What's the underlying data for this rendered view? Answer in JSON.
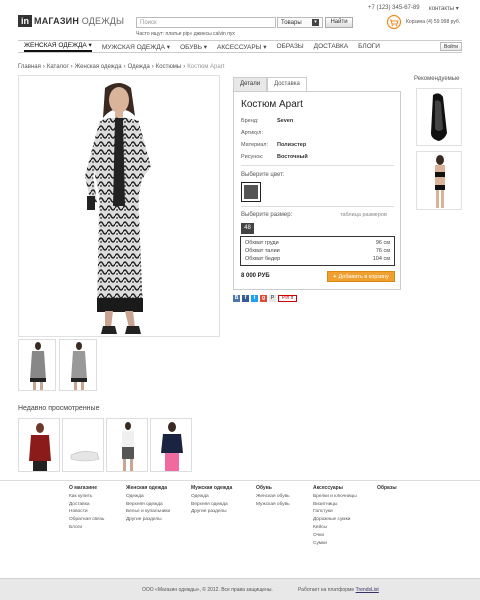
{
  "header": {
    "logo_mark": "in",
    "logo_word": "МАГАЗИН",
    "logo_word2": "ОДЕЖДЫ",
    "search_placeholder": "Поиск",
    "category": "Товары",
    "find_label": "Найти",
    "often_search": "Часто ищут: платье pip» джинсы calvin пух",
    "phone": "+7 (123) 345-67-89",
    "contacts": "контакты ▾",
    "cart_text": "Корзина (4) 59 998 руб."
  },
  "nav": {
    "items": [
      "ЖЕНСКАЯ ОДЕЖДА ▾",
      "МУЖСКАЯ ОДЕЖДА ▾",
      "ОБУВЬ ▾",
      "АКСЕССУАРЫ ▾",
      "ОБРАЗЫ",
      "ДОСТАВКА",
      "БЛОГИ"
    ],
    "login": "Войти"
  },
  "breadcrumb": [
    "Главная",
    "Каталог",
    "Женская одежда",
    "Одежда",
    "Костюмы",
    "Костюм Apart"
  ],
  "details": {
    "tabs": [
      "Детали",
      "Доставка"
    ],
    "title": "Костюм Apart",
    "specs": [
      {
        "label": "Бренд:",
        "value": "Seven"
      },
      {
        "label": "Артикул:",
        "value": ""
      },
      {
        "label": "Материал:",
        "value": "Полиэстер"
      },
      {
        "label": "Рисунок:",
        "value": "Восточный"
      }
    ],
    "color_label": "Выберите цвет:",
    "size_label": "Выберите размер:",
    "size_table": "таблица размеров",
    "size": "48",
    "measurements": [
      {
        "name": "Обхват груди",
        "value": "96 см"
      },
      {
        "name": "Обхват талии",
        "value": "76 см"
      },
      {
        "name": "Обхват бедер",
        "value": "104 см"
      }
    ],
    "price": "8 000 РУБ",
    "add_to_cart": "Добавить в корзину",
    "social": [
      "B",
      "f",
      "t",
      "g",
      "P"
    ],
    "pinterest": "Pin it"
  },
  "recommended": {
    "title": "Рекомендуемые"
  },
  "recent": {
    "title": "Недавно просмотренные"
  },
  "footer": {
    "columns": [
      {
        "title": "О магазине",
        "items": [
          "Как купить",
          "Доставка",
          "Новости",
          "Обратная связь",
          "Блоги"
        ]
      },
      {
        "title": "Женская одежда",
        "items": [
          "Одежда",
          "Верхняя одежда",
          "Белье и купальники",
          "Другие разделы"
        ]
      },
      {
        "title": "Мужская одежда",
        "items": [
          "Одежда",
          "Верхняя одежда",
          "Другие разделы"
        ]
      },
      {
        "title": "Обувь",
        "items": [
          "Женская обувь",
          "Мужская обувь"
        ]
      },
      {
        "title": "Аксессуары",
        "items": [
          "Брелки и ключницы",
          "Визитницы",
          "Галстуки",
          "Дорожные сумки",
          "Кейсы",
          "Очки",
          "Сумки"
        ]
      },
      {
        "title": "Образы",
        "items": []
      }
    ],
    "copyright": "ООО «Магазин одежды», © 2012. Все права защищены.",
    "platform_prefix": "Работает на платформе",
    "platform_link": "TrendsList"
  },
  "colors": {
    "accent": "#f0a030",
    "nav_active": "#111111",
    "cart_icon": "#f08a20"
  }
}
